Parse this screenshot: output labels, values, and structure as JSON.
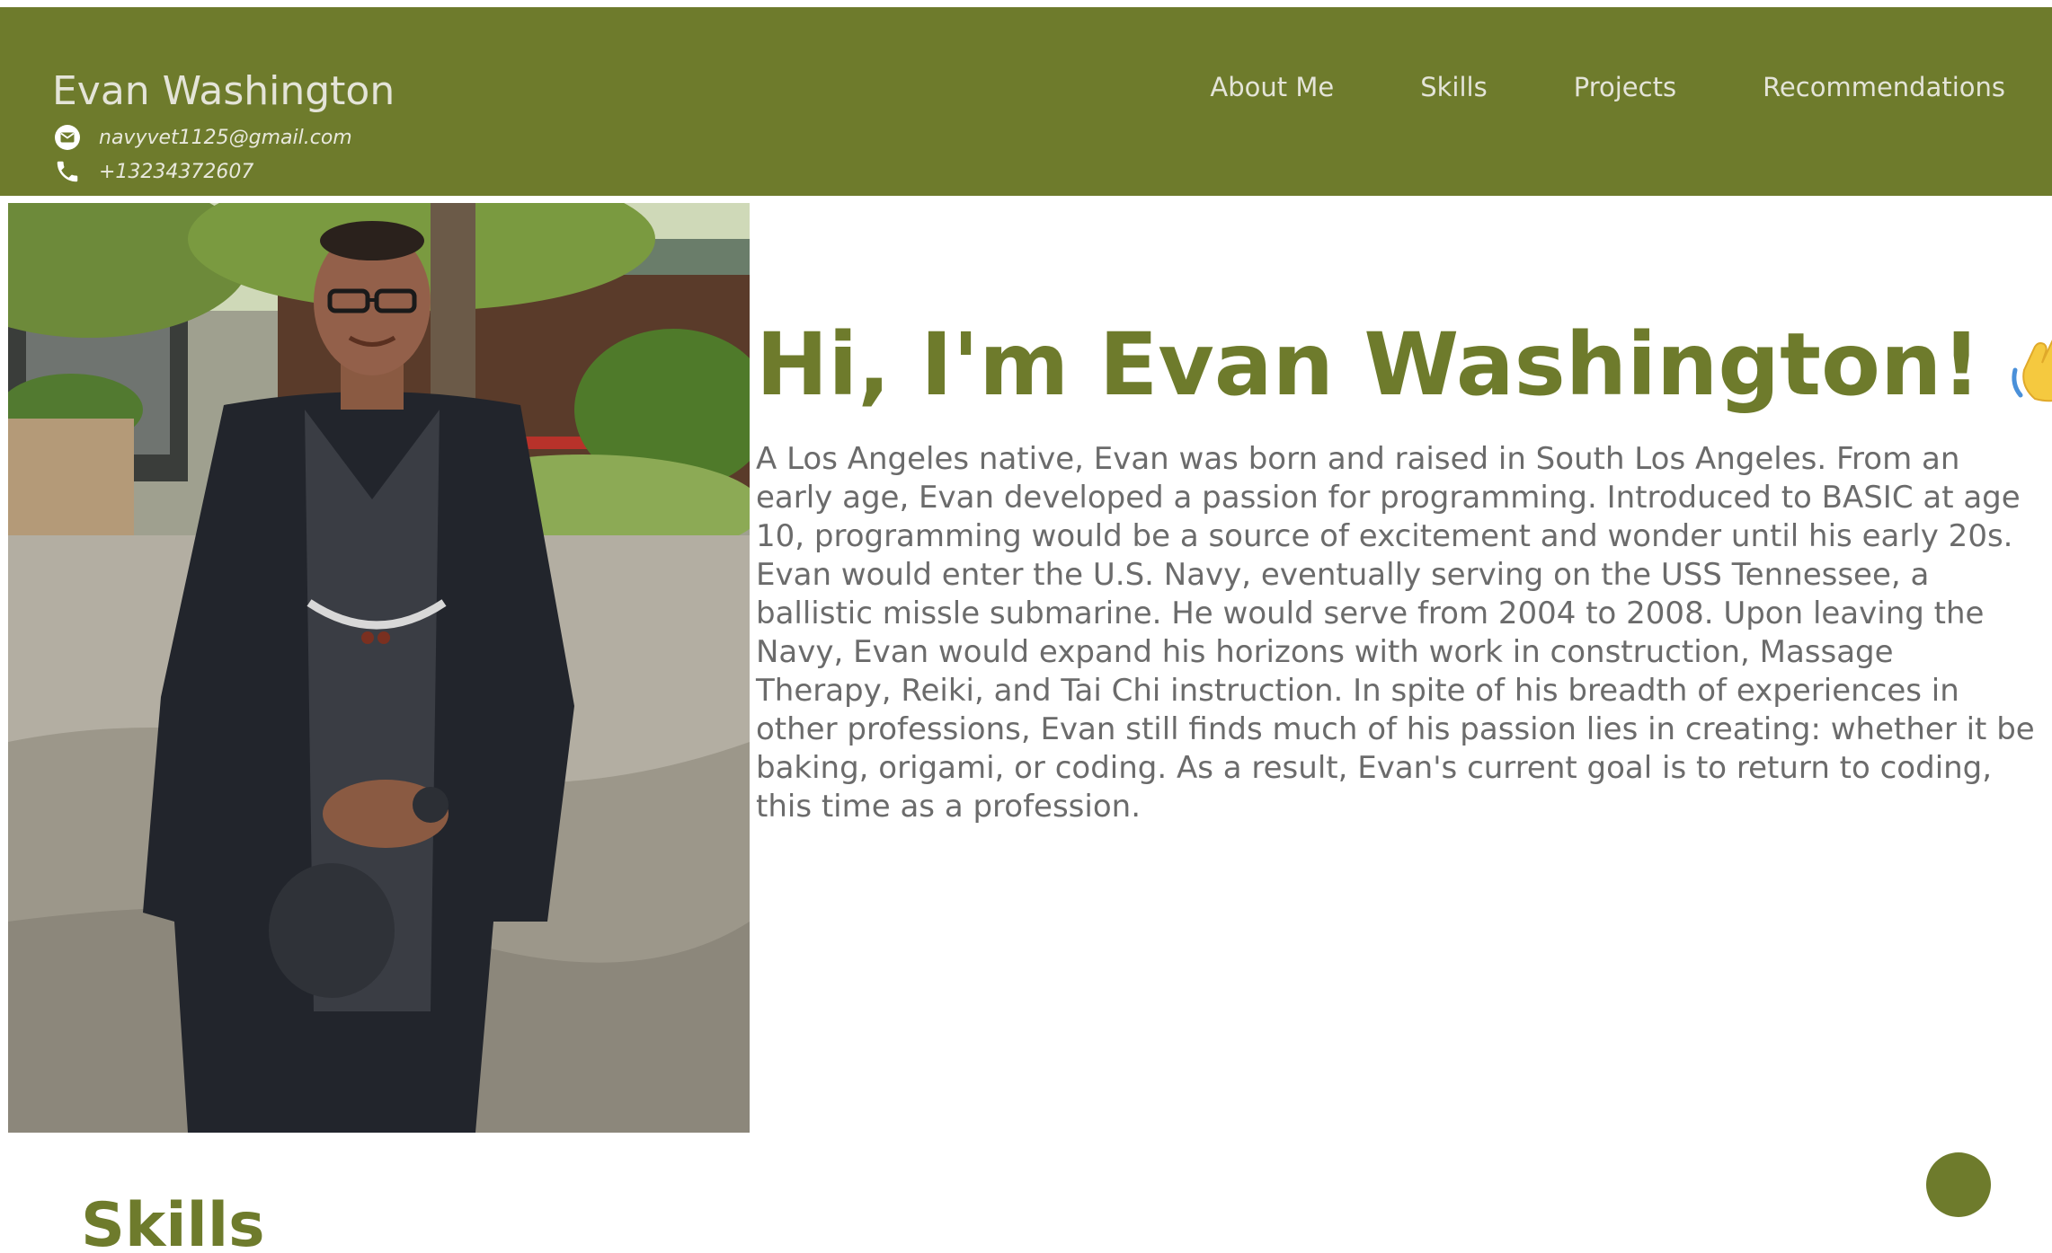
{
  "header": {
    "name": "Evan Washington",
    "email": "navyvet1125@gmail.com",
    "phone": "+13234372607",
    "email_icon": "envelope-icon",
    "phone_icon": "phone-icon",
    "background_color": "#6e7b2c"
  },
  "nav": {
    "items": [
      {
        "label": "About Me"
      },
      {
        "label": "Skills"
      },
      {
        "label": "Projects"
      },
      {
        "label": "Recommendations"
      }
    ]
  },
  "hero": {
    "title": "Hi, I'm Evan Washington!",
    "emoji": "waving-hand-icon",
    "bio": "A Los Angeles native, Evan was born and raised in South Los Angeles. From an early age, Evan developed a passion for programming. Introduced to BASIC at age 10, programming would be a source of excitement and wonder until his early 20s. Evan would enter the U.S. Navy, eventually serving on the USS Tennessee, a ballistic missle submarine. He would serve from 2004 to 2008. Upon leaving the Navy, Evan would expand his horizons with work in construction, Massage Therapy, Reiki, and Tai Chi instruction. In spite of his breadth of experiences in other professions, Evan still finds much of his passion lies in creating: whether it be baking, origami, or coding. As a result, Evan's current goal is to return to coding, this time as a profession."
  },
  "skills": {
    "heading": "Skills"
  },
  "colors": {
    "accent": "#6e7b2c",
    "body_text": "#6b6b6b",
    "header_text": "#e4e4d8"
  }
}
